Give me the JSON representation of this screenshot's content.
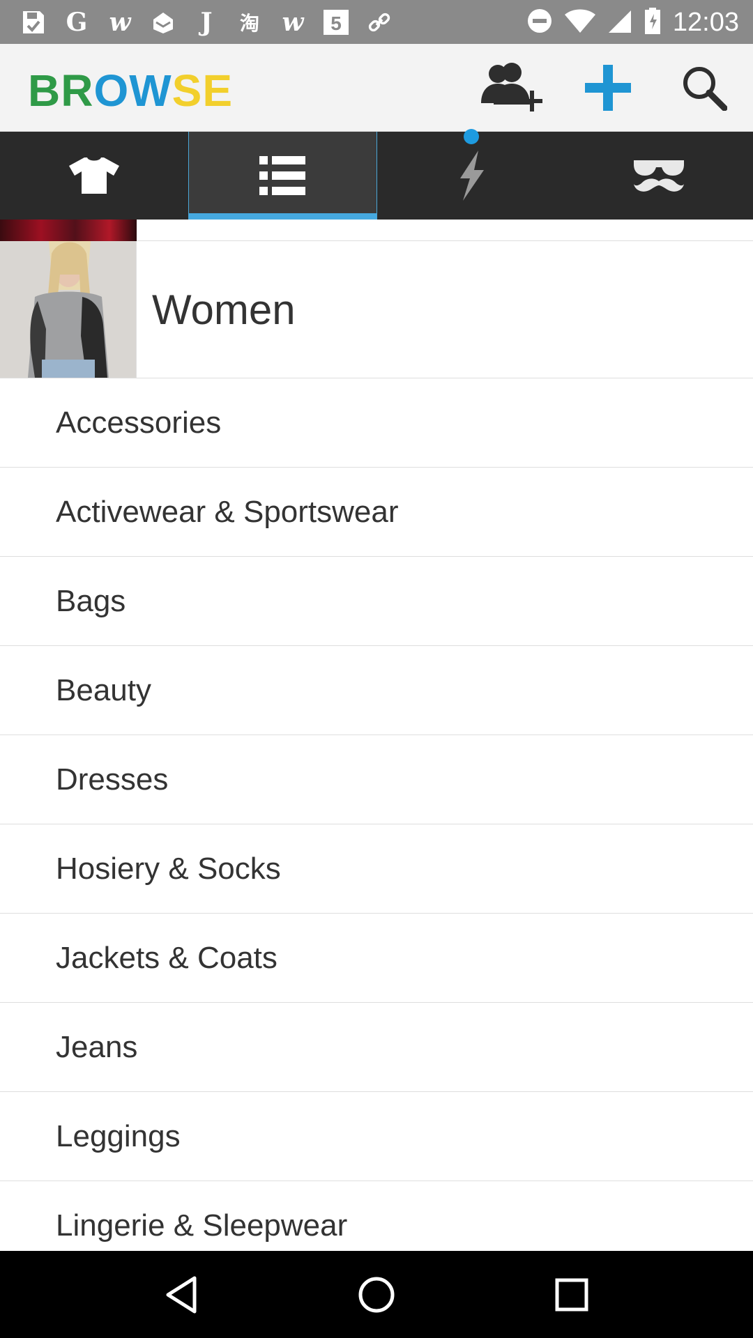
{
  "status_bar": {
    "time": "12:03",
    "left_icons": [
      "save-notification-icon",
      "google-icon",
      "wish-icon",
      "inbox-icon",
      "j-icon",
      "taobao-icon",
      "wish-icon",
      "html5-icon",
      "link-icon"
    ],
    "right_icons": [
      "do-not-disturb-icon",
      "wifi-icon",
      "signal-icon",
      "battery-icon"
    ],
    "background_color": "#8a8a8a"
  },
  "header": {
    "brand_part1": "BR",
    "brand_part2": "OW",
    "brand_part3": "SE",
    "actions": [
      "add-friend-icon",
      "plus-icon",
      "search-icon"
    ],
    "colors": {
      "green": "#2f9a47",
      "blue": "#1f95d3",
      "yellow": "#f2cf2c"
    }
  },
  "tabs": [
    {
      "icon": "tshirt-icon",
      "active": false
    },
    {
      "icon": "list-icon",
      "active": true
    },
    {
      "icon": "lightning-icon",
      "active": false,
      "badge": true
    },
    {
      "icon": "sunglasses-mustache-icon",
      "active": false
    }
  ],
  "section": {
    "title": "Women"
  },
  "categories": [
    "Accessories",
    "Activewear & Sportswear",
    "Bags",
    "Beauty",
    "Dresses",
    "Hosiery & Socks",
    "Jackets & Coats",
    "Jeans",
    "Leggings",
    "Lingerie & Sleepwear"
  ],
  "nav_bar": [
    "back-icon",
    "home-icon",
    "recents-icon"
  ],
  "accent_color": "#46a9e0"
}
